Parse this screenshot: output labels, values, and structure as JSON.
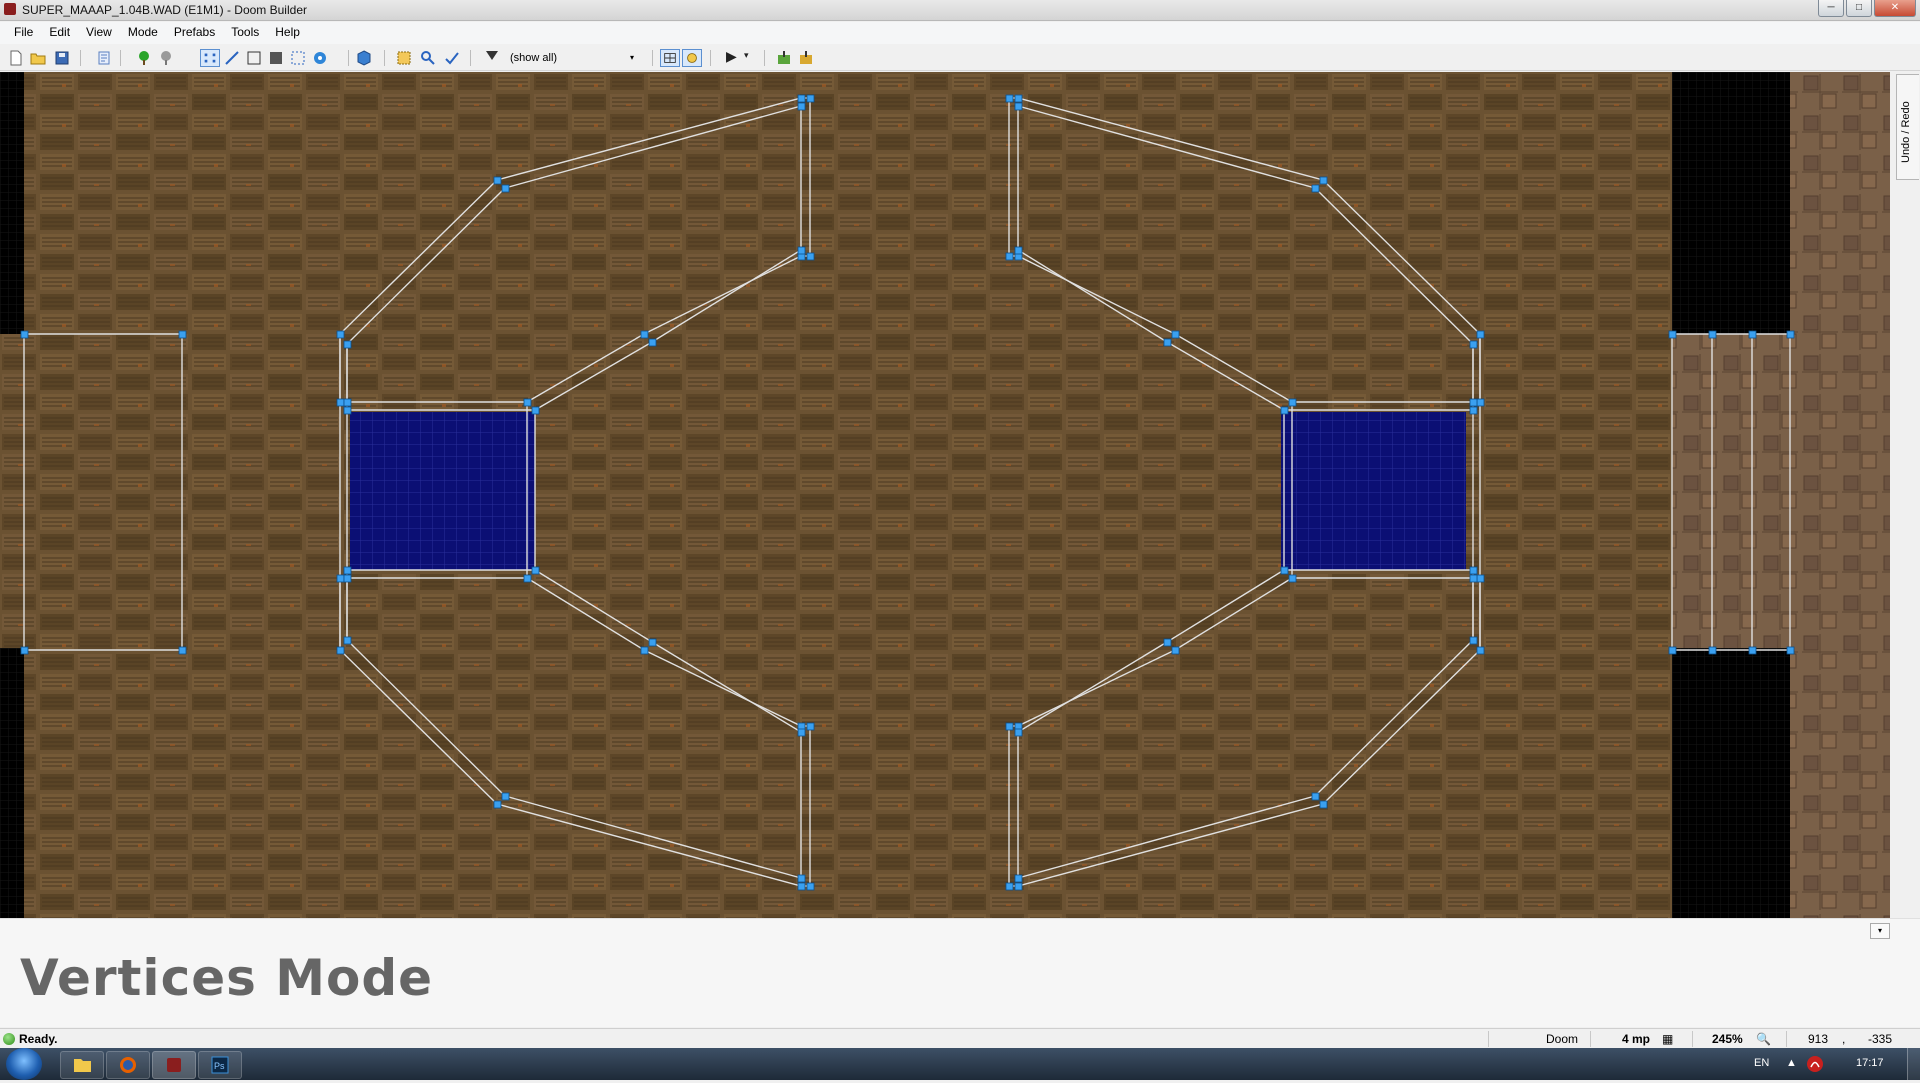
{
  "window": {
    "title": "SUPER_MAAAP_1.04B.WAD (E1M1) - Doom Builder",
    "min": "─",
    "max": "□",
    "close": "✕"
  },
  "menu": [
    "File",
    "Edit",
    "View",
    "Mode",
    "Prefabs",
    "Tools",
    "Help"
  ],
  "toolbar": {
    "filter_value": "(show all)",
    "play_arrow": "▶",
    "dropdown_arrow": "▾"
  },
  "sidebar": {
    "undo_redo_label": "Undo / Redo"
  },
  "mode_panel": {
    "title": "Vertices Mode",
    "collapse": "▾"
  },
  "status": {
    "text": "Ready.",
    "game_config": "Doom",
    "grid_size": "4 mp",
    "zoom": "245%",
    "coord_x": "913",
    "coord_sep": ",",
    "coord_y": "-335"
  },
  "taskbar": {
    "language": "EN",
    "clock": "17:17"
  },
  "colors": {
    "floor": "#6b5232",
    "water": "#0b0f74",
    "linedef": "#d8d8d8",
    "vertex": "#3aa0f0"
  }
}
